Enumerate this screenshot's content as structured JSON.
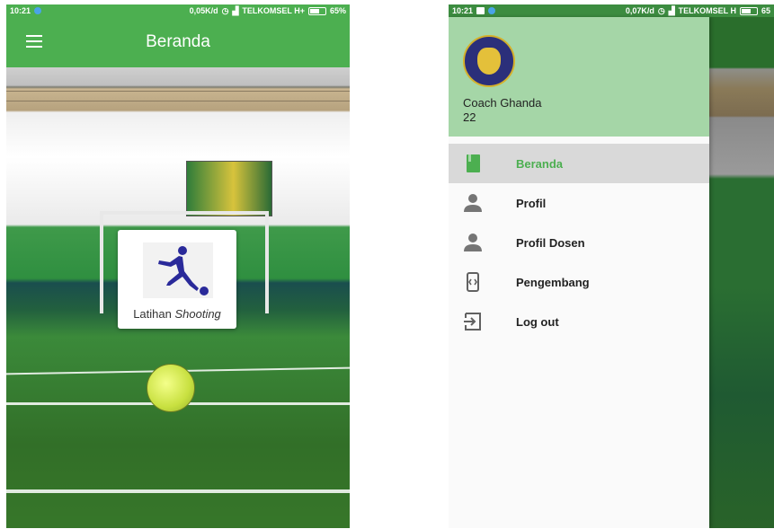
{
  "screen1": {
    "status_bar": {
      "time": "10:21",
      "net_speed": "0,05K/d",
      "carrier": "TELKOMSEL H+",
      "battery": "65%"
    },
    "app_bar": {
      "title": "Beranda",
      "menu_icon": "hamburger-menu-icon"
    },
    "card": {
      "label_plain": "Latihan ",
      "label_italic": "Shooting",
      "icon": "soccer-player-kicking-icon"
    },
    "colors": {
      "primary": "#4caf50"
    }
  },
  "screen2": {
    "status_bar": {
      "time": "10:21",
      "net_speed": "0,07K/d",
      "carrier": "TELKOMSEL H",
      "battery": "65"
    },
    "drawer": {
      "header": {
        "name": "Coach Ghanda",
        "subtitle": "22",
        "logo": "university-logo"
      },
      "items": [
        {
          "label": "Beranda",
          "icon": "book-icon",
          "active": true
        },
        {
          "label": "Profil",
          "icon": "person-icon",
          "active": false
        },
        {
          "label": "Profil Dosen",
          "icon": "person-icon",
          "active": false
        },
        {
          "label": "Pengembang",
          "icon": "code-icon",
          "active": false
        },
        {
          "label": "Log out",
          "icon": "logout-icon",
          "active": false
        }
      ]
    },
    "colors": {
      "header": "#a5d6a7",
      "active_bg": "#d9d9d9",
      "active_text": "#4caf50"
    }
  }
}
